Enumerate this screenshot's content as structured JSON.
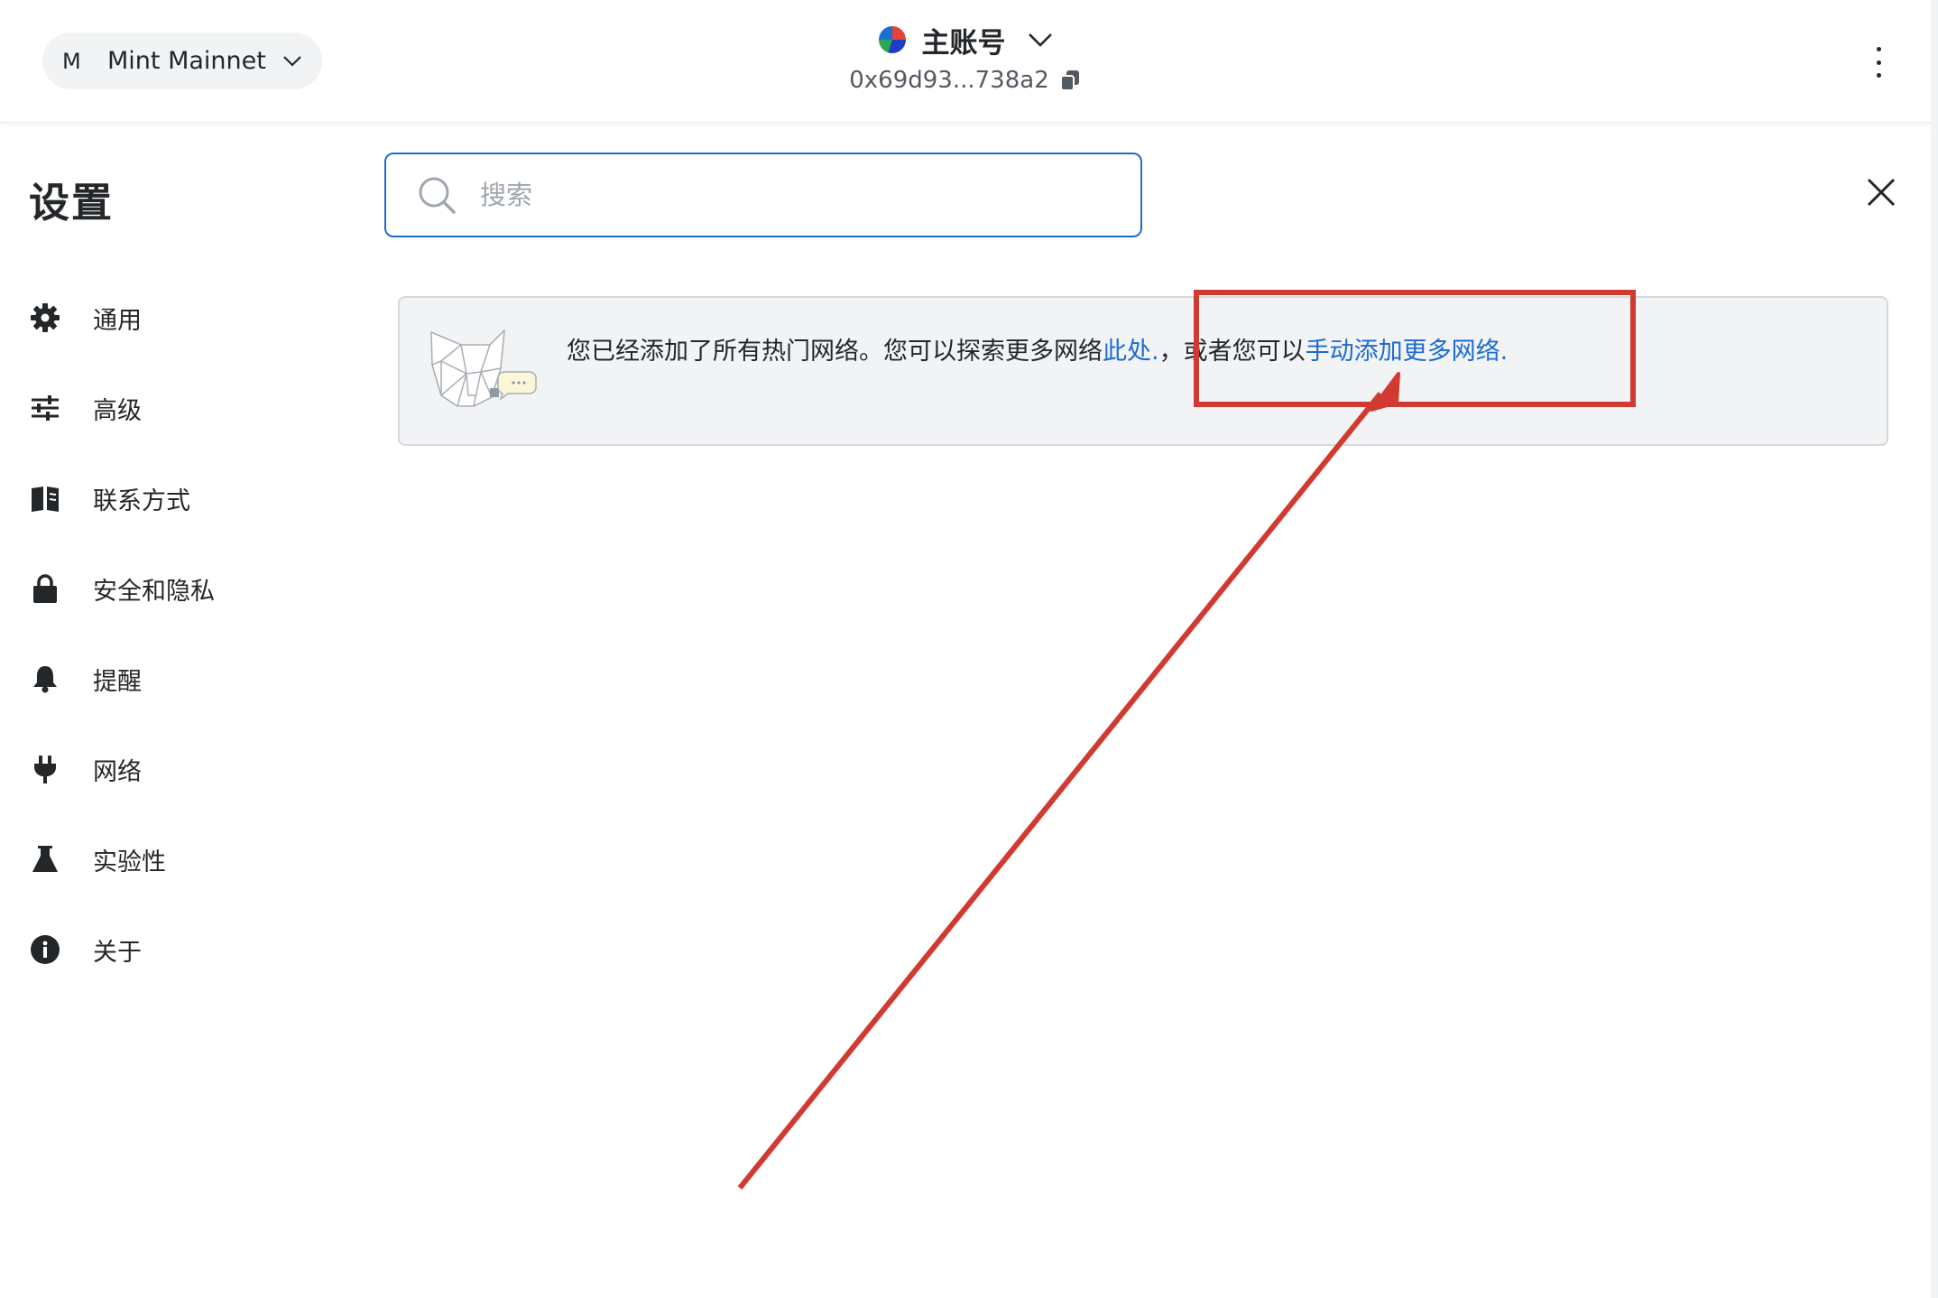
{
  "header": {
    "network": {
      "initial": "M",
      "name": "Mint Mainnet"
    },
    "account": {
      "name": "主账号",
      "address": "0x69d93...738a2"
    }
  },
  "settings": {
    "title": "设置",
    "sidebar_items": [
      {
        "label": "通用",
        "icon": "gear-icon"
      },
      {
        "label": "高级",
        "icon": "sliders-icon"
      },
      {
        "label": "联系方式",
        "icon": "book-icon"
      },
      {
        "label": "安全和隐私",
        "icon": "lock-icon"
      },
      {
        "label": "提醒",
        "icon": "bell-icon"
      },
      {
        "label": "网络",
        "icon": "plug-icon"
      },
      {
        "label": "实验性",
        "icon": "flask-icon"
      },
      {
        "label": "关于",
        "icon": "info-icon"
      }
    ]
  },
  "search": {
    "placeholder": "搜索",
    "value": ""
  },
  "banner": {
    "text_before": "您已经添加了所有热门网络。您可以探索更多网络",
    "link_here": "此处.",
    "text_middle": "，或者您可以",
    "link_manual": "手动添加更多网络."
  },
  "colors": {
    "accent": "#1c6bd1",
    "annotation": "#d13a30",
    "banner_bg": "#f2f3f4"
  }
}
